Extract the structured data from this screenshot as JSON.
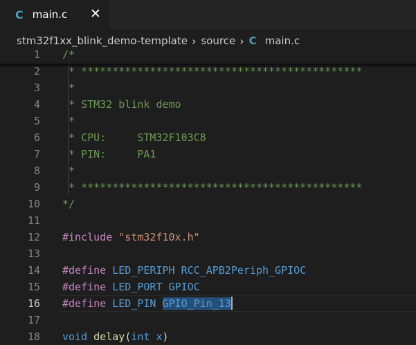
{
  "tab": {
    "icon": "C",
    "label": "main.c"
  },
  "breadcrumb": {
    "folder": "stm32f1xx_blink_demo-template",
    "subfolder": "source",
    "icon": "C",
    "file": "main.c"
  },
  "editor": {
    "active_line": "16",
    "lines": [
      {
        "n": "1",
        "tokens": [
          {
            "t": "/*",
            "c": "cm"
          }
        ]
      },
      {
        "n": "2",
        "tokens": [
          {
            "t": " * *********************************************",
            "c": "cm"
          }
        ]
      },
      {
        "n": "3",
        "tokens": [
          {
            "t": " *",
            "c": "cm"
          }
        ]
      },
      {
        "n": "4",
        "tokens": [
          {
            "t": " * STM32 blink demo",
            "c": "cm"
          }
        ]
      },
      {
        "n": "5",
        "tokens": [
          {
            "t": " *",
            "c": "cm"
          }
        ]
      },
      {
        "n": "6",
        "tokens": [
          {
            "t": " * CPU:     STM32F103C8",
            "c": "cm"
          }
        ]
      },
      {
        "n": "7",
        "tokens": [
          {
            "t": " * PIN:     PA1",
            "c": "cm"
          }
        ]
      },
      {
        "n": "8",
        "tokens": [
          {
            "t": " *",
            "c": "cm"
          }
        ]
      },
      {
        "n": "9",
        "tokens": [
          {
            "t": " * *********************************************",
            "c": "cm"
          }
        ]
      },
      {
        "n": "10",
        "tokens": [
          {
            "t": "*/",
            "c": "cm"
          }
        ]
      },
      {
        "n": "11",
        "tokens": []
      },
      {
        "n": "12",
        "tokens": [
          {
            "t": "#include ",
            "c": "kw"
          },
          {
            "t": "\"stm32f10x.h\"",
            "c": "str"
          }
        ]
      },
      {
        "n": "13",
        "tokens": []
      },
      {
        "n": "14",
        "tokens": [
          {
            "t": "#define ",
            "c": "kw"
          },
          {
            "t": "LED_PERIPH ",
            "c": "mac"
          },
          {
            "t": "RCC_APB2Periph_GPIOC",
            "c": "mac"
          }
        ]
      },
      {
        "n": "15",
        "tokens": [
          {
            "t": "#define ",
            "c": "kw"
          },
          {
            "t": "LED_PORT ",
            "c": "mac"
          },
          {
            "t": "GPIOC",
            "c": "mac"
          }
        ]
      },
      {
        "n": "16",
        "tokens": [
          {
            "t": "#define ",
            "c": "kw"
          },
          {
            "t": "LED_PIN ",
            "c": "mac"
          },
          {
            "t": "GPIO_Pin_13",
            "c": "mac",
            "sel": true
          }
        ]
      },
      {
        "n": "17",
        "tokens": []
      },
      {
        "n": "18",
        "tokens": [
          {
            "t": "void ",
            "c": "mac"
          },
          {
            "t": "delay",
            "c": "fn"
          },
          {
            "t": "(",
            "c": "plain"
          },
          {
            "t": "int ",
            "c": "mac"
          },
          {
            "t": "x",
            "c": "mac"
          },
          {
            "t": ")",
            "c": "plain"
          }
        ]
      }
    ]
  }
}
